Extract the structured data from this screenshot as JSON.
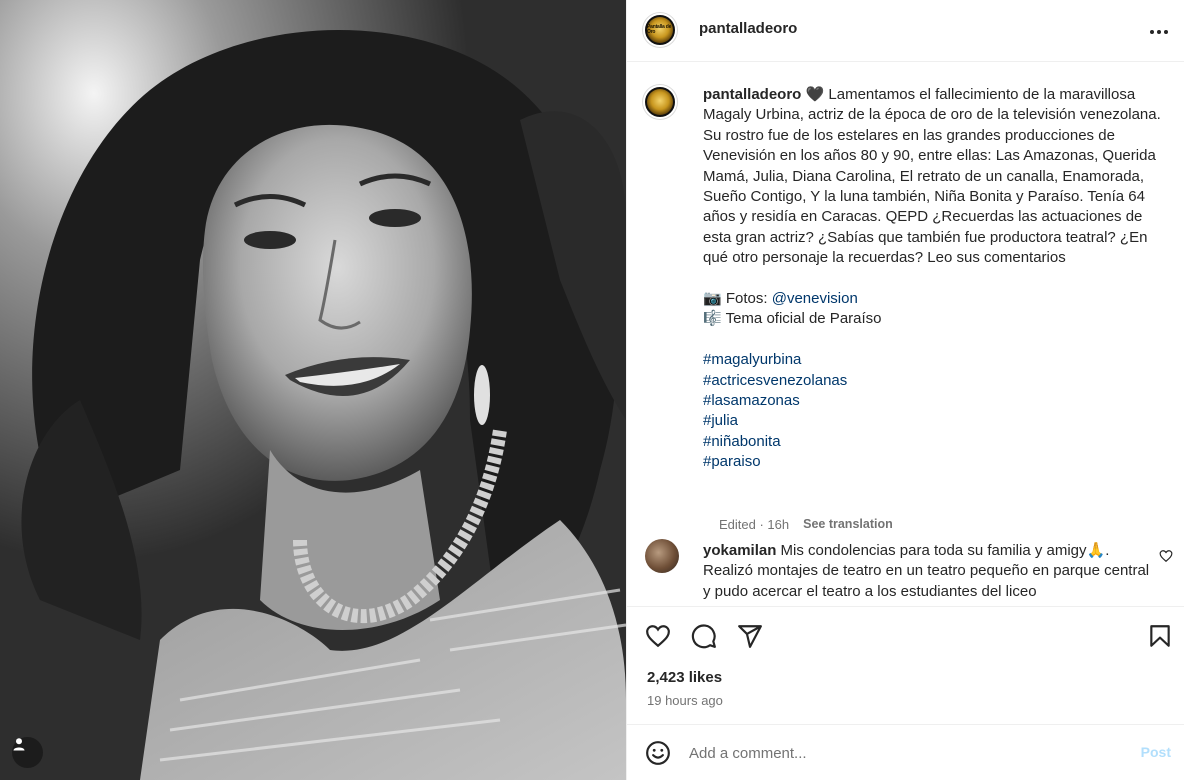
{
  "post": {
    "username": "pantalladeoro",
    "avatar_text": "Pantalla de Oro",
    "caption": {
      "intro_emoji": "🖤",
      "body": "Lamentamos el fallecimiento de la maravillosa Magaly Urbina, actriz de la época de oro de la televisión venezolana. Su rostro fue de los estelares en las grandes producciones de Venevisión en los años 80 y 90, entre ellas: Las Amazonas, Querida Mamá, Julia, Diana Carolina, El retrato de un canalla, Enamorada, Sueño Contigo, Y la luna también, Niña Bonita y Paraíso. Tenía 64 años y residía en Caracas. QEPD ¿Recuerdas las actuaciones de esta gran actriz? ¿Sabías que también fue productora teatral? ¿En qué otro personaje la recuerdas? Leo sus comentarios",
      "photos_emoji": "📷",
      "photos_label": "Fotos: ",
      "photos_mention": "@venevision",
      "music_emoji": "🎼",
      "music_label": "Tema oficial de Paraíso",
      "hashtags": [
        "#magalyurbina",
        "#actricesvenezolanas",
        "#lasamazonas",
        "#julia",
        "#niñabonita",
        "#paraiso"
      ]
    },
    "edited_label": "Edited · 16h",
    "see_translation": "See translation",
    "likes": "2,423 likes",
    "time_ago": "19 hours ago"
  },
  "comments": [
    {
      "username": "yokamilan",
      "text": "Mis condolencias para toda su familia y amigy🙏. Realizó montajes de teatro en un teatro pequeño en parque central y pudo acercar el teatro a los estudiantes del liceo"
    }
  ],
  "comment_box": {
    "placeholder": "Add a comment...",
    "post_label": "Post"
  },
  "icons": {
    "more": "more-horizontal-icon",
    "like": "heart-icon",
    "comment": "comment-bubble-icon",
    "share": "paper-plane-icon",
    "save": "bookmark-icon",
    "emoji": "smiley-icon",
    "tag": "user-tag-icon"
  },
  "colors": {
    "link": "#00376b",
    "muted": "#737373",
    "post_disabled": "#b2dffc",
    "border": "#efefef"
  }
}
